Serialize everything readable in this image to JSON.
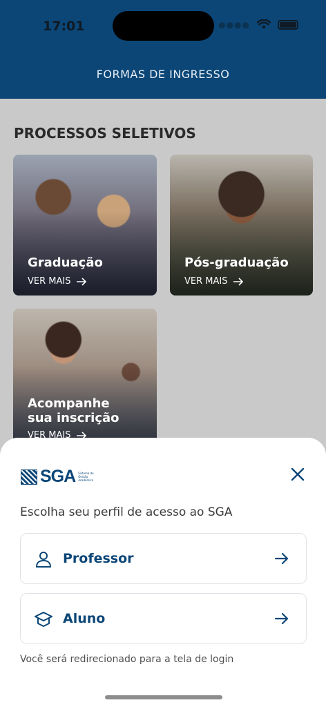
{
  "status_bar": {
    "time": "17:01"
  },
  "header": {
    "title": "FORMAS DE INGRESSO"
  },
  "section": {
    "title": "PROCESSOS SELETIVOS"
  },
  "cards": [
    {
      "title": "Graduação",
      "cta": "VER MAIS"
    },
    {
      "title": "Pós-graduação",
      "cta": "VER MAIS"
    },
    {
      "title_line1": "Acompanhe",
      "title_line2": "sua inscrição",
      "cta": "VER MAIS"
    }
  ],
  "sheet": {
    "logo": {
      "text": "SGA",
      "subtitle": "Sistema de Gestão Acadêmica"
    },
    "title": "Escolha seu perfil de acesso ao SGA",
    "options": [
      {
        "label": "Professor",
        "icon": "person-icon"
      },
      {
        "label": "Aluno",
        "icon": "graduation-cap-icon"
      }
    ],
    "note": "Você será redirecionado para a tela de login"
  },
  "colors": {
    "brand": "#0b4677",
    "overlay": "#c9c9c9"
  }
}
